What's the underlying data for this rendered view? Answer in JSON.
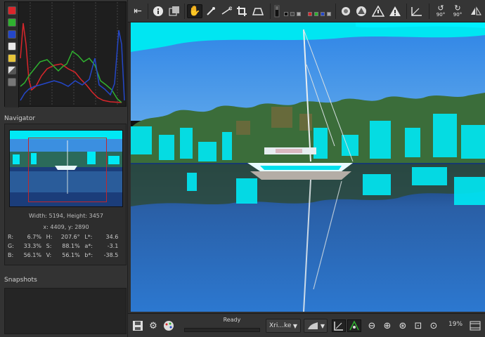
{
  "histogram": {
    "tools": [
      {
        "icon": "red-channel-icon",
        "color": "#d9262b"
      },
      {
        "icon": "green-channel-icon",
        "color": "#2fb12f"
      },
      {
        "icon": "blue-channel-icon",
        "color": "#2447c9"
      },
      {
        "icon": "luminance-icon",
        "color": "#e8e8e8"
      },
      {
        "icon": "chroma-icon",
        "color": "#e7c43a"
      },
      {
        "icon": "raw-icon",
        "color": "#bbbbbb"
      },
      {
        "icon": "bar-icon",
        "color": "#888888"
      }
    ]
  },
  "navigator": {
    "title": "Navigator",
    "dimensions": "Width: 5194, Height: 3457",
    "coords": "x: 4409, y: 2890",
    "values": [
      {
        "k1": "R:",
        "v1": "6.7%",
        "k2": "H:",
        "v2": "207.6°",
        "k3": "L*:",
        "v3": "34.6"
      },
      {
        "k1": "G:",
        "v1": "33.3%",
        "k2": "S:",
        "v2": "88.1%",
        "k3": "a*:",
        "v3": "-3.1"
      },
      {
        "k1": "B:",
        "v1": "56.1%",
        "k2": "V:",
        "v2": "56.1%",
        "k3": "b*:",
        "v3": "-38.5"
      }
    ]
  },
  "snapshots": {
    "title": "Snapshots"
  },
  "toolbar": {
    "icons": [
      "collapse-left-icon",
      "info-icon",
      "compare-icon",
      "hand-icon",
      "color-picker-icon",
      "straighten-icon",
      "crop-icon",
      "perspective-icon",
      "background-icon",
      "clip-shadow-icon",
      "clip-highlight-icon",
      "warning-icon",
      "warning-filled-icon",
      "focus-mask-icon",
      "rotate-left-icon",
      "rotate-right-icon",
      "flip-icon"
    ],
    "rotate_left_label": "90°",
    "rotate_right_label": "90°",
    "swatches": [
      "#111111",
      "#444444",
      "#aaaaaa",
      "#d9262b",
      "#2fb12f",
      "#2447c9",
      "#aaaaaa"
    ]
  },
  "bottombar": {
    "status": "Ready",
    "profile": "Xri...ke",
    "zoom": "19%"
  }
}
